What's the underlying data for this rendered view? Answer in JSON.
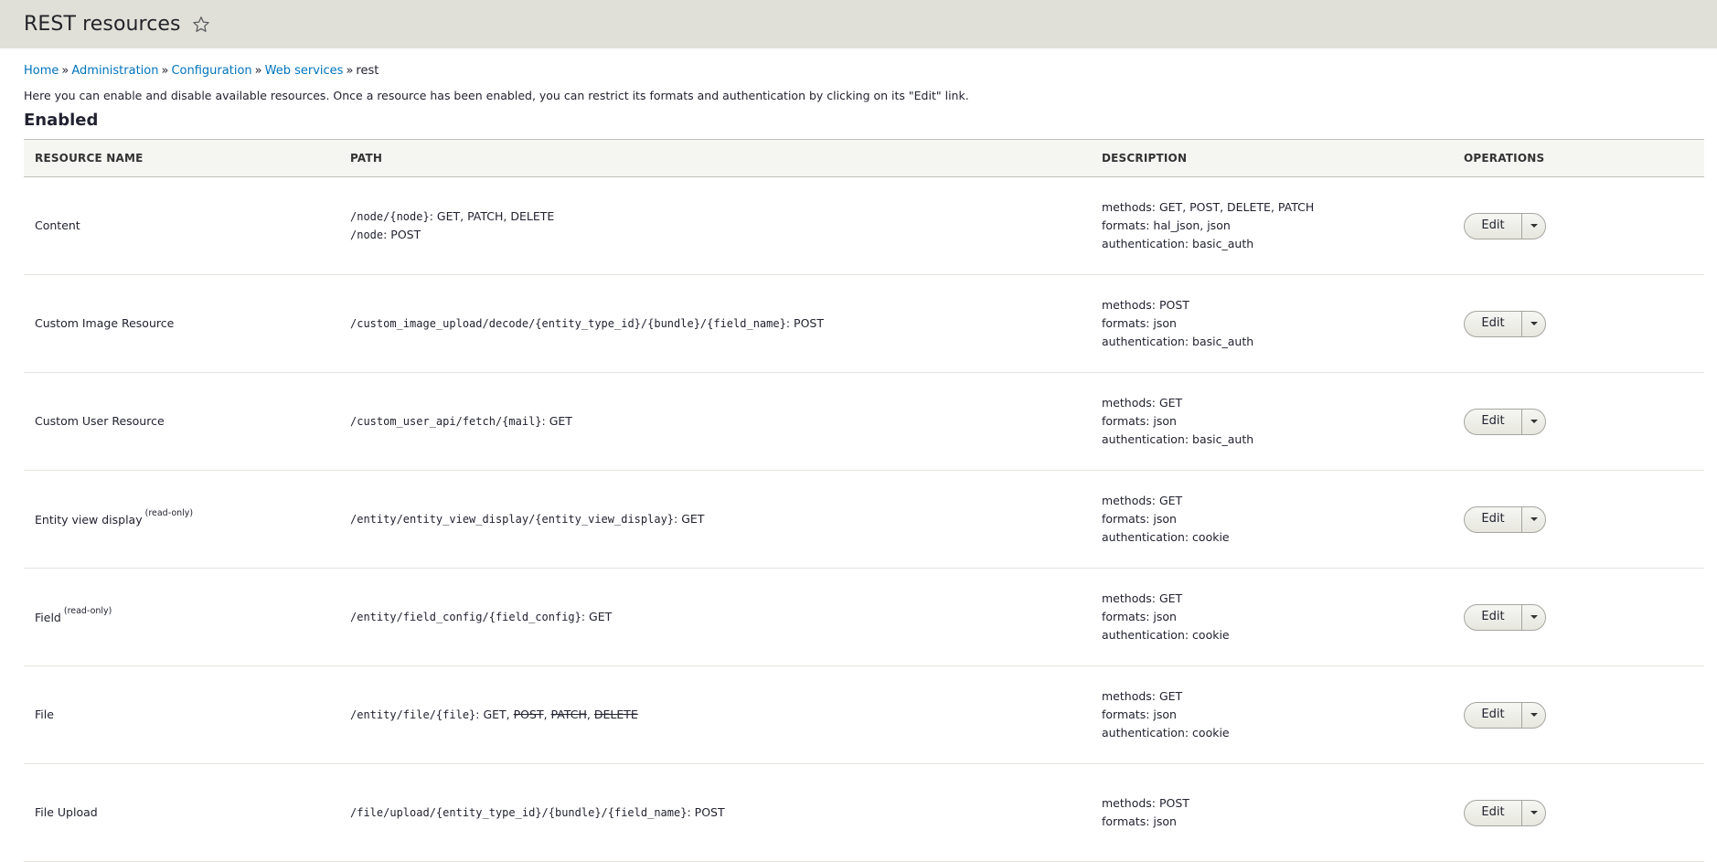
{
  "page": {
    "title": "REST resources",
    "breadcrumb": [
      {
        "label": "Home"
      },
      {
        "label": "Administration"
      },
      {
        "label": "Configuration"
      },
      {
        "label": "Web services"
      }
    ],
    "breadcrumb_current": "rest",
    "breadcrumb_separator": "»",
    "help_text": "Here you can enable and disable available resources. Once a resource has been enabled, you can restrict its formats and authentication by clicking on its \"Edit\" link.",
    "section_title": "Enabled"
  },
  "table": {
    "headers": {
      "name": "RESOURCE NAME",
      "path": "PATH",
      "description": "DESCRIPTION",
      "operations": "OPERATIONS"
    },
    "rows": [
      {
        "name": "Content",
        "readonly": "",
        "paths": [
          {
            "pre": "/node/",
            "pa": "{node}",
            "post": "",
            "methods": ": GET, PATCH, DELETE"
          },
          {
            "pre": "/node",
            "pa": "",
            "post": "",
            "methods": ": POST"
          }
        ],
        "methods": "methods: GET, POST, DELETE, PATCH",
        "formats": "formats: hal_json, json",
        "auth": "authentication: basic_auth",
        "edit_label": "Edit"
      },
      {
        "name": "Custom Image Resource",
        "readonly": "",
        "paths": [
          {
            "pre": "/custom_image_upload/decode/",
            "pa": "{entity_type_id}/{bundle}/{field_name}",
            "post": "",
            "methods": ": POST"
          }
        ],
        "methods": "methods: POST",
        "formats": "formats: json",
        "auth": "authentication: basic_auth",
        "edit_label": "Edit"
      },
      {
        "name": "Custom User Resource",
        "readonly": "",
        "paths": [
          {
            "pre": "/custom_user_api/fetch/",
            "pa": "{mail}",
            "post": "",
            "methods": ": GET"
          }
        ],
        "methods": "methods: GET",
        "formats": "formats: json",
        "auth": "authentication: basic_auth",
        "edit_label": "Edit"
      },
      {
        "name": "Entity view display",
        "readonly": "(read-only)",
        "paths": [
          {
            "pre": "/entity/entity_view_display/",
            "pa": "{entity_view_display}",
            "post": "",
            "methods": ": GET"
          }
        ],
        "methods": "methods: GET",
        "formats": "formats: json",
        "auth": "authentication: cookie",
        "edit_label": "Edit"
      },
      {
        "name": "Field",
        "readonly": "(read-only)",
        "paths": [
          {
            "pre": "/entity/field_config/",
            "pa": "{field_config}",
            "post": "",
            "methods": ": GET"
          }
        ],
        "methods": "methods: GET",
        "formats": "formats: json",
        "auth": "authentication: cookie",
        "edit_label": "Edit"
      },
      {
        "name": "File",
        "readonly": "",
        "paths": [
          {
            "pre": "/entity/file/",
            "pa": "{file}",
            "post": "",
            "methods": ": GET, ",
            "struck": [
              "POST",
              "PATCH",
              "DELETE"
            ]
          }
        ],
        "methods": "methods: GET",
        "formats": "formats: json",
        "auth": "authentication: cookie",
        "edit_label": "Edit"
      },
      {
        "name": "File Upload",
        "readonly": "",
        "paths": [
          {
            "pre": "/file/upload/",
            "pa": "{entity_type_id}/{bundle}/{field_name}",
            "post": "",
            "methods": ": POST"
          }
        ],
        "methods": "methods: POST",
        "formats": "formats: json",
        "auth": "",
        "edit_label": "Edit"
      }
    ]
  }
}
